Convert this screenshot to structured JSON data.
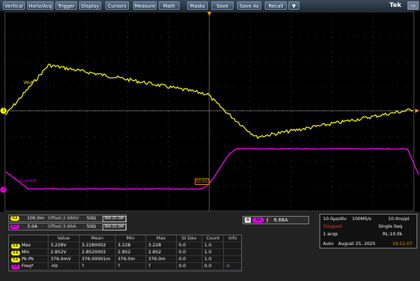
{
  "menu": {
    "items": [
      "Vertical",
      "Horiz/Acq",
      "Trigger",
      "Display",
      "Cursors",
      "Measure",
      "Math",
      "Masks",
      "Save",
      "Save As",
      "Recall",
      "▼"
    ],
    "brand": "Tek",
    "window_control": "▭"
  },
  "waveforms": {
    "vout_label": "Vout",
    "current_label": "Current",
    "threshold_marker": "50.0%",
    "ch1_marker": "1",
    "ch2_marker": "2",
    "colors": {
      "ch1": "#f2f200",
      "ch2": "#e000e0",
      "trigger": "#f29a00",
      "grid": "#3c3c3c"
    }
  },
  "channels": [
    {
      "tag": "C1",
      "scale": "100.0m",
      "offset": "Offset:2.986V",
      "impedance": "50Ω",
      "bandwidth": "BW:20.0M",
      "color": "#f2f200"
    },
    {
      "tag": "C2",
      "scale": "3.0A",
      "offset": "Offset:3.96A",
      "impedance": "50Ω",
      "bandwidth": "BW:20.0M",
      "color": "#e000e0"
    }
  ],
  "trigger": {
    "source_tag": "A",
    "channel_tag": "C2",
    "slope": "⨍",
    "level": "6.66A"
  },
  "measurements": {
    "headers": [
      "",
      "Value",
      "Mean",
      "Min",
      "Max",
      "St Dev",
      "Count",
      "Info"
    ],
    "rows": [
      {
        "tag": "C1",
        "name": "Max",
        "value": "3.228V",
        "mean": "3.2280002",
        "min": "3.228",
        "max": "3.228",
        "stdev": "0.0",
        "count": "1.0",
        "info": ""
      },
      {
        "tag": "C1",
        "name": "Min",
        "value": "2.852V",
        "mean": "2.8520002",
        "min": "2.852",
        "max": "2.852",
        "stdev": "0.0",
        "count": "1.0",
        "info": ""
      },
      {
        "tag": "C1",
        "name": "Pk-Pk",
        "value": "376.0mV",
        "mean": "376.00001m",
        "min": "376.0m",
        "max": "376.0m",
        "stdev": "0.0",
        "count": "1.0",
        "info": ""
      },
      {
        "tag": "C2",
        "name": "Freq*",
        "value": "-Hz",
        "mean": "?",
        "min": "?",
        "max": "?",
        "stdev": "0.0",
        "count": "0.0",
        "info": "⊙"
      }
    ]
  },
  "horizontal": {
    "timebase": "10.0µs/div",
    "sample_rate": "100MS/s",
    "resolution": "10.0ns/pt",
    "state": "Stopped",
    "seq_mode": "Single Seq",
    "acqs": "1 acqs",
    "record_length": "RL:10.0k",
    "trigger_mode": "Auto",
    "date": "August 25, 2025",
    "time": "19:11:07"
  }
}
